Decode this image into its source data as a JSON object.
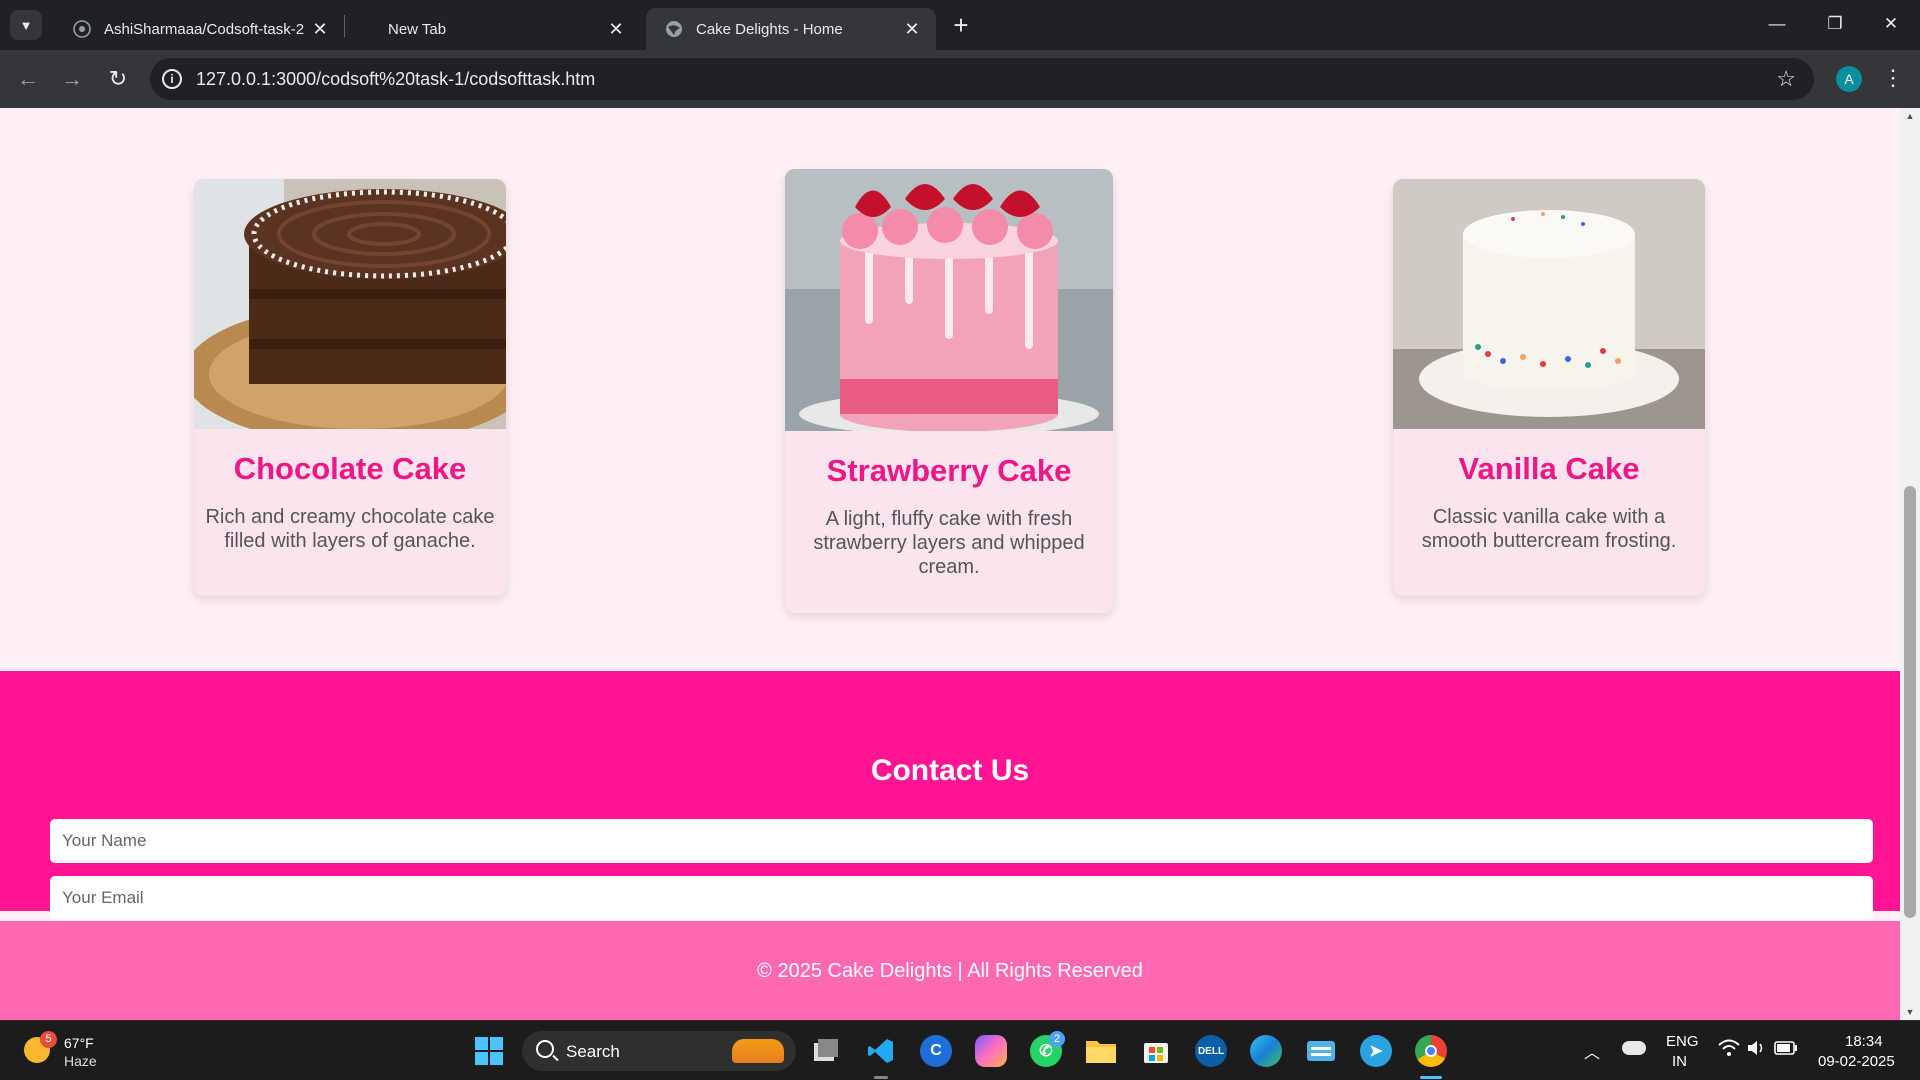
{
  "browser": {
    "tabs": [
      {
        "title": "AshiSharmaaa/Codsoft-task-2",
        "icon": "github-icon",
        "active": false
      },
      {
        "title": "New Tab",
        "icon": "none",
        "active": false
      },
      {
        "title": "Cake Delights - Home",
        "icon": "globe-icon",
        "active": true
      }
    ],
    "url": "127.0.0.1:3000/codsoft%20task-1/codsofttask.htm",
    "profile_initial": "A"
  },
  "page": {
    "cakes": [
      {
        "name": "Chocolate Cake",
        "description": "Rich and creamy chocolate cake filled with layers of ganache."
      },
      {
        "name": "Strawberry Cake",
        "description": "A light, fluffy cake with fresh strawberry layers and whipped cream."
      },
      {
        "name": "Vanilla Cake",
        "description": "Classic vanilla cake with a smooth buttercream frosting."
      }
    ],
    "contact": {
      "heading": "Contact Us",
      "name_placeholder": "Your Name",
      "email_placeholder": "Your Email"
    },
    "footer": "© 2025 Cake Delights | All Rights Reserved",
    "colors": {
      "accent": "#ff1493",
      "footer": "#ff69b4",
      "background": "#fff0f5"
    }
  },
  "taskbar": {
    "weather": {
      "temp": "67°F",
      "condition": "Haze",
      "badge": "5"
    },
    "search_label": "Search",
    "whatsapp_badge": "2",
    "tray": {
      "lang_top": "ENG",
      "lang_bottom": "IN",
      "time": "18:34",
      "date": "09-02-2025"
    }
  }
}
